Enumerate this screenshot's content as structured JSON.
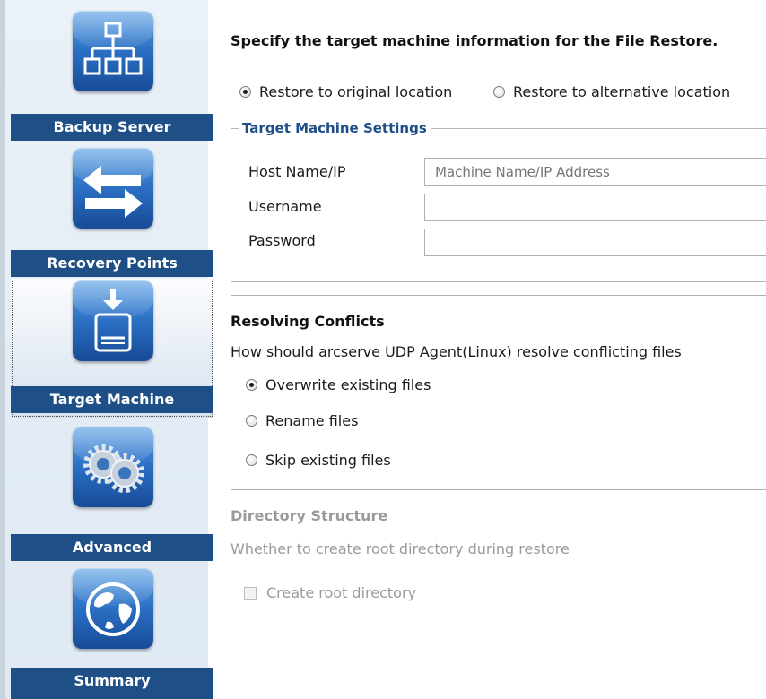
{
  "sidebar": {
    "items": [
      {
        "label": "Backup Server",
        "icon": "backup-server-icon"
      },
      {
        "label": "Recovery Points",
        "icon": "recovery-points-icon"
      },
      {
        "label": "Target Machine",
        "icon": "target-machine-icon",
        "selected": true
      },
      {
        "label": "Advanced",
        "icon": "advanced-gears-icon"
      },
      {
        "label": "Summary",
        "icon": "summary-globe-icon"
      }
    ]
  },
  "main": {
    "heading": "Specify the target machine information for the File Restore.",
    "location": {
      "original": "Restore to original location",
      "alternative": "Restore to alternative location",
      "selected": "original"
    },
    "target_settings": {
      "legend": "Target Machine Settings",
      "host_label": "Host Name/IP",
      "host_placeholder": "Machine Name/IP Address",
      "username_label": "Username",
      "username_value": "",
      "password_label": "Password",
      "password_value": ""
    },
    "conflicts": {
      "title": "Resolving Conflicts",
      "description": "How should arcserve UDP Agent(Linux) resolve conflicting files",
      "options": [
        "Overwrite existing files",
        "Rename files",
        "Skip existing files"
      ],
      "selected": "Overwrite existing files"
    },
    "directory": {
      "title": "Directory Structure",
      "description": "Whether to create root directory during restore",
      "checkbox_label": "Create root directory",
      "checked": false
    }
  },
  "colors": {
    "sidebar_label_bg": "#1e4f86",
    "legend_text": "#1f4f88",
    "disabled_text": "#9a9a9a"
  }
}
